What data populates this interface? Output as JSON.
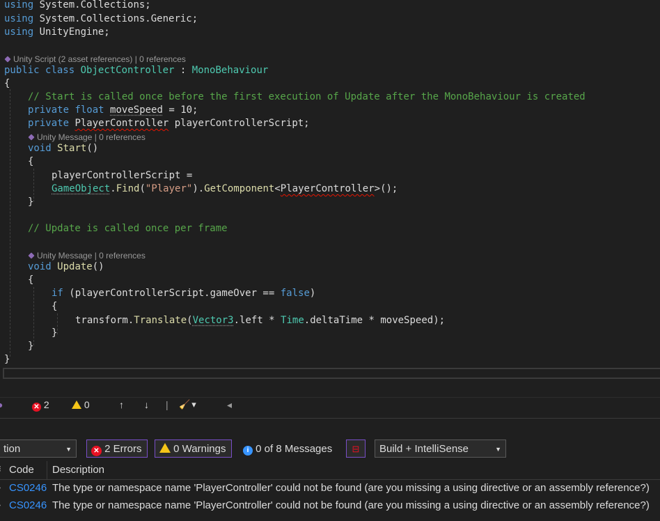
{
  "editor": {
    "lines": {
      "l1": {
        "kw": "using",
        "rest": " System.Collections;"
      },
      "l2": {
        "kw": "using",
        "rest": " System.Collections.Generic;"
      },
      "l3": {
        "kw": "using",
        "rest": " UnityEngine;"
      },
      "lens_class": "Unity Script (2 asset references) | 0 references",
      "class_decl": {
        "kw1": "public",
        "kw2": "class",
        "name": "ObjectController",
        "colon": " : ",
        "base": "MonoBehaviour"
      },
      "open_brace": "{",
      "comment1": "// Start is called once before the first execution of Update after the MonoBehaviour is created",
      "field1": {
        "kw1": "private",
        "kw2": "float",
        "name": "moveSpeed",
        "rest": " = 10;"
      },
      "field2": {
        "kw1": "private",
        "type": "PlayerController",
        "rest": " playerControllerScript;"
      },
      "lens_start": "Unity Message | 0 references",
      "start_decl": {
        "kw": "void",
        "name": "Start",
        "paren": "()"
      },
      "start_open": "{",
      "assign1": "playerControllerScript =",
      "assign2": {
        "type": "GameObject",
        "dot": ".",
        "fn": "Find",
        "p1": "(",
        "str": "\"Player\"",
        "p2": ").",
        "fn2": "GetComponent",
        "lt": "<",
        "gtype": "PlayerController",
        "end": ">();"
      },
      "start_close": "}",
      "comment2": "// Update is called once per frame",
      "lens_update": "Unity Message | 0 references",
      "update_decl": {
        "kw": "void",
        "name": "Update",
        "paren": "()"
      },
      "update_open": "{",
      "if_line": {
        "kw": "if",
        "rest1": " (playerControllerScript.gameOver == ",
        "val": "false",
        "rest2": ")"
      },
      "if_open": "{",
      "translate": {
        "id": "transform.",
        "fn": "Translate",
        "p": "(",
        "type": "Vector3",
        "r1": ".left * ",
        "type2": "Time",
        "r2": ".deltaTime * moveSpeed);"
      },
      "if_close": "}",
      "update_close": "}",
      "class_close": "}"
    }
  },
  "statusstrip": {
    "errors": "2",
    "warnings": "0",
    "up_arrow": "↑",
    "down_arrow": "↓",
    "sep": "|",
    "broom": "🧹",
    "dropdown": "▾",
    "left_arrow": "◂"
  },
  "errorlist": {
    "scope_value": "tion",
    "errors_label": "2 Errors",
    "warnings_label": "0 Warnings",
    "messages_label": "0 of 8 Messages",
    "source_value": "Build + IntelliSense",
    "columns": {
      "code": "Code",
      "description": "Description"
    },
    "rows": [
      {
        "code": "CS0246",
        "description": "The type or namespace name 'PlayerController' could not be found (are you missing a using directive or an assembly reference?)"
      },
      {
        "code": "CS0246",
        "description": "The type or namespace name 'PlayerController' could not be found (are you missing a using directive or an assembly reference?)"
      }
    ]
  },
  "colors": {
    "keyword": "#569cd6",
    "type": "#4ec9b0",
    "method": "#dcdcaa",
    "string": "#d69d85",
    "comment": "#57a64a",
    "error": "#e81123",
    "link": "#3794ff"
  }
}
